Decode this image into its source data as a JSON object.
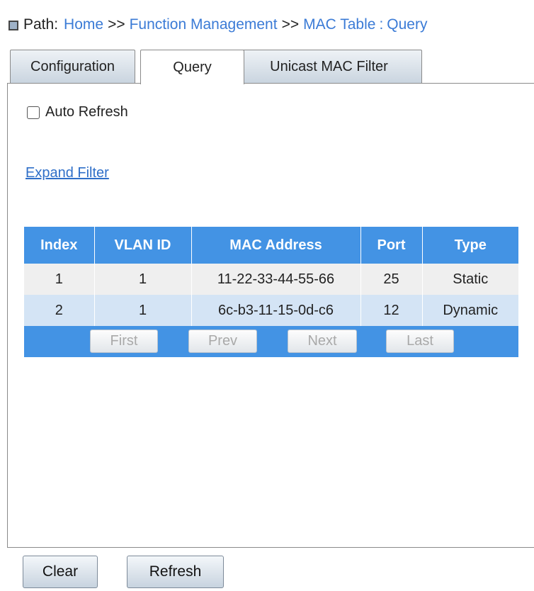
{
  "path": {
    "label": "Path:",
    "home": "Home",
    "sep1": ">>",
    "section": "Function Management",
    "sep2": ">>",
    "page": "MAC Table",
    "colon": ":",
    "subpage": "Query"
  },
  "tabs": [
    {
      "label": "Configuration",
      "active": false
    },
    {
      "label": "Query",
      "active": true
    },
    {
      "label": "Unicast MAC Filter",
      "active": false
    }
  ],
  "auto_refresh": {
    "label": "Auto Refresh",
    "checked": false
  },
  "expand_filter": "Expand Filter",
  "table": {
    "headers": [
      "Index",
      "VLAN ID",
      "MAC Address",
      "Port",
      "Type"
    ],
    "rows": [
      [
        "1",
        "1",
        "11-22-33-44-55-66",
        "25",
        "Static"
      ],
      [
        "2",
        "1",
        "6c-b3-11-15-0d-c6",
        "12",
        "Dynamic"
      ]
    ]
  },
  "pager": {
    "first": "First",
    "prev": "Prev",
    "next": "Next",
    "last": "Last"
  },
  "buttons": {
    "clear": "Clear",
    "refresh": "Refresh"
  },
  "colors": {
    "header_blue": "#4393e4",
    "link_blue": "#3b7bd6",
    "row_alt": "#d4e4f5",
    "row_base": "#efefef"
  }
}
